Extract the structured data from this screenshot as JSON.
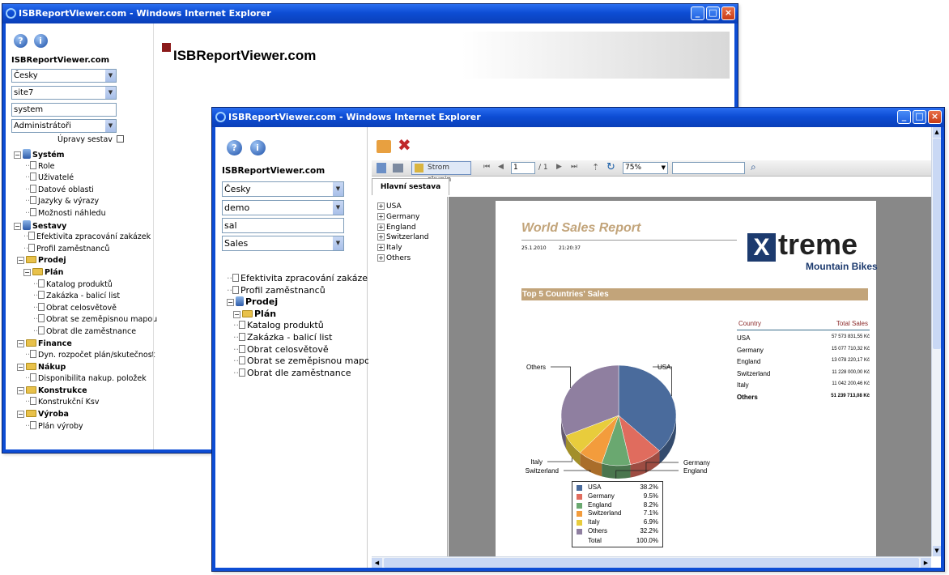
{
  "back_window": {
    "title": "ISBReportViewer.com - Windows Internet Explorer",
    "site_title": "ISBReportViewer.com",
    "header_title": "ISBReportViewer.com",
    "language": "Česky",
    "site": "site7",
    "user": "system",
    "role": "Administrátoři",
    "edit_label": "Úpravy sestav",
    "tree": [
      {
        "label": "Systém",
        "kind": "system",
        "bold": true
      },
      {
        "label": "Role",
        "kind": "doc"
      },
      {
        "label": "Uživatelé",
        "kind": "doc"
      },
      {
        "label": "Datové oblasti",
        "kind": "doc"
      },
      {
        "label": "Jazyky & výrazy",
        "kind": "doc"
      },
      {
        "label": "Možnosti náhledu",
        "kind": "doc"
      },
      {
        "label": "Sestavy",
        "kind": "system",
        "bold": true
      },
      {
        "label": "Efektivita zpracování zakázek",
        "kind": "doc"
      },
      {
        "label": "Profil zaměstnanců",
        "kind": "doc"
      },
      {
        "label": "Prodej",
        "kind": "folder",
        "bold": true
      },
      {
        "label": "Plán",
        "kind": "folder",
        "bold": true
      },
      {
        "label": "Katalog produktů",
        "kind": "doc"
      },
      {
        "label": "Zakázka - balicí list",
        "kind": "doc"
      },
      {
        "label": "Obrat celosvětově",
        "kind": "doc"
      },
      {
        "label": "Obrat se zeměpisnou mapou",
        "kind": "doc"
      },
      {
        "label": "Obrat dle zaměstnance",
        "kind": "doc"
      },
      {
        "label": "Finance",
        "kind": "folder",
        "bold": true
      },
      {
        "label": "Dyn. rozpočet plán/skutečnost",
        "kind": "doc"
      },
      {
        "label": "Nákup",
        "kind": "folder",
        "bold": true
      },
      {
        "label": "Disponibilita nakup. položek",
        "kind": "doc"
      },
      {
        "label": "Konstrukce",
        "kind": "folder",
        "bold": true
      },
      {
        "label": "Konstrukční Ksv",
        "kind": "doc"
      },
      {
        "label": "Výroba",
        "kind": "folder",
        "bold": true
      },
      {
        "label": "Plán výroby",
        "kind": "doc"
      }
    ]
  },
  "front_window": {
    "title": "ISBReportViewer.com - Windows Internet Explorer",
    "site_title": "ISBReportViewer.com",
    "language": "Česky",
    "site": "demo",
    "user": "sal",
    "role": "Sales",
    "tree": [
      {
        "label": "Efektivita zpracování zakázek",
        "kind": "doc"
      },
      {
        "label": "Profil zaměstnanců",
        "kind": "doc"
      },
      {
        "label": "Prodej",
        "kind": "system",
        "bold": true
      },
      {
        "label": "Plán",
        "kind": "folder",
        "bold": true
      },
      {
        "label": "Katalog produktů",
        "kind": "doc"
      },
      {
        "label": "Zakázka - balicí list",
        "kind": "doc"
      },
      {
        "label": "Obrat celosvětově",
        "kind": "doc"
      },
      {
        "label": "Obrat se zeměpisnou mapou",
        "kind": "doc"
      },
      {
        "label": "Obrat dle zaměstnance",
        "kind": "doc"
      }
    ],
    "toolbar": {
      "group_tree_label": "Strom skupin",
      "page_number": "1",
      "page_total": "/ 1",
      "zoom": "75%",
      "search": ""
    },
    "tab_label": "Hlavní sestava",
    "group_tree": [
      "USA",
      "Germany",
      "England",
      "Switzerland",
      "Italy",
      "Others"
    ],
    "report": {
      "title": "World Sales Report",
      "date": "25.1.2010",
      "time": "21:20:37",
      "logo_main": "treme",
      "logo_sub": "Mountain Bikes",
      "section_title": "Top 5 Countries' Sales",
      "table_headers": [
        "Country",
        "Total Sales"
      ],
      "table_rows": [
        {
          "country": "USA",
          "sales": "57 573 831,55 Kč"
        },
        {
          "country": "Germany",
          "sales": "15 077 710,32 Kč"
        },
        {
          "country": "England",
          "sales": "13 078 220,17 Kč"
        },
        {
          "country": "Switzerland",
          "sales": "11 228 000,00 Kč"
        },
        {
          "country": "Italy",
          "sales": "11 042 200,46 Kč"
        },
        {
          "country": "Others",
          "sales": "51 239 713,08 Kč"
        }
      ],
      "legend_total_label": "Total",
      "legend_total_value": "100.0%"
    }
  },
  "chart_data": {
    "type": "pie",
    "title": "",
    "categories": [
      "USA",
      "Germany",
      "England",
      "Switzerland",
      "Italy",
      "Others"
    ],
    "values": [
      38.2,
      9.5,
      8.2,
      7.1,
      6.9,
      32.2
    ],
    "value_labels": [
      "38.2%",
      "9.5%",
      "8.2%",
      "7.1%",
      "6.9%",
      "32.2%"
    ],
    "colors": [
      "#4a6b9c",
      "#e06c5e",
      "#6aa870",
      "#f39c3c",
      "#e8cc3c",
      "#8f7fa0"
    ],
    "legend_placement": "bottom"
  }
}
